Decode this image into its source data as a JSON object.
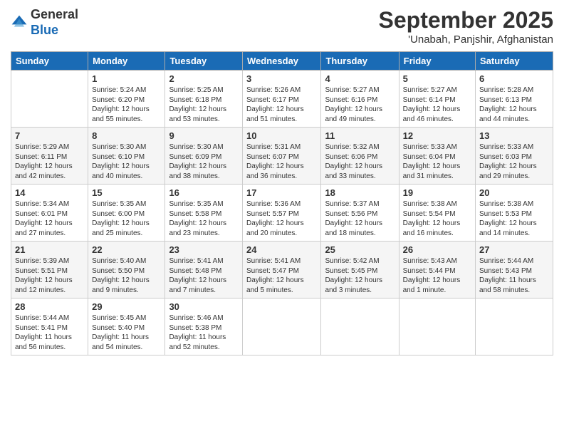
{
  "header": {
    "logo_general": "General",
    "logo_blue": "Blue",
    "month": "September 2025",
    "location": "'Unabah, Panjshir, Afghanistan"
  },
  "columns": [
    "Sunday",
    "Monday",
    "Tuesday",
    "Wednesday",
    "Thursday",
    "Friday",
    "Saturday"
  ],
  "weeks": [
    [
      {
        "day": "",
        "info": ""
      },
      {
        "day": "1",
        "info": "Sunrise: 5:24 AM\nSunset: 6:20 PM\nDaylight: 12 hours\nand 55 minutes."
      },
      {
        "day": "2",
        "info": "Sunrise: 5:25 AM\nSunset: 6:18 PM\nDaylight: 12 hours\nand 53 minutes."
      },
      {
        "day": "3",
        "info": "Sunrise: 5:26 AM\nSunset: 6:17 PM\nDaylight: 12 hours\nand 51 minutes."
      },
      {
        "day": "4",
        "info": "Sunrise: 5:27 AM\nSunset: 6:16 PM\nDaylight: 12 hours\nand 49 minutes."
      },
      {
        "day": "5",
        "info": "Sunrise: 5:27 AM\nSunset: 6:14 PM\nDaylight: 12 hours\nand 46 minutes."
      },
      {
        "day": "6",
        "info": "Sunrise: 5:28 AM\nSunset: 6:13 PM\nDaylight: 12 hours\nand 44 minutes."
      }
    ],
    [
      {
        "day": "7",
        "info": "Sunrise: 5:29 AM\nSunset: 6:11 PM\nDaylight: 12 hours\nand 42 minutes."
      },
      {
        "day": "8",
        "info": "Sunrise: 5:30 AM\nSunset: 6:10 PM\nDaylight: 12 hours\nand 40 minutes."
      },
      {
        "day": "9",
        "info": "Sunrise: 5:30 AM\nSunset: 6:09 PM\nDaylight: 12 hours\nand 38 minutes."
      },
      {
        "day": "10",
        "info": "Sunrise: 5:31 AM\nSunset: 6:07 PM\nDaylight: 12 hours\nand 36 minutes."
      },
      {
        "day": "11",
        "info": "Sunrise: 5:32 AM\nSunset: 6:06 PM\nDaylight: 12 hours\nand 33 minutes."
      },
      {
        "day": "12",
        "info": "Sunrise: 5:33 AM\nSunset: 6:04 PM\nDaylight: 12 hours\nand 31 minutes."
      },
      {
        "day": "13",
        "info": "Sunrise: 5:33 AM\nSunset: 6:03 PM\nDaylight: 12 hours\nand 29 minutes."
      }
    ],
    [
      {
        "day": "14",
        "info": "Sunrise: 5:34 AM\nSunset: 6:01 PM\nDaylight: 12 hours\nand 27 minutes."
      },
      {
        "day": "15",
        "info": "Sunrise: 5:35 AM\nSunset: 6:00 PM\nDaylight: 12 hours\nand 25 minutes."
      },
      {
        "day": "16",
        "info": "Sunrise: 5:35 AM\nSunset: 5:58 PM\nDaylight: 12 hours\nand 23 minutes."
      },
      {
        "day": "17",
        "info": "Sunrise: 5:36 AM\nSunset: 5:57 PM\nDaylight: 12 hours\nand 20 minutes."
      },
      {
        "day": "18",
        "info": "Sunrise: 5:37 AM\nSunset: 5:56 PM\nDaylight: 12 hours\nand 18 minutes."
      },
      {
        "day": "19",
        "info": "Sunrise: 5:38 AM\nSunset: 5:54 PM\nDaylight: 12 hours\nand 16 minutes."
      },
      {
        "day": "20",
        "info": "Sunrise: 5:38 AM\nSunset: 5:53 PM\nDaylight: 12 hours\nand 14 minutes."
      }
    ],
    [
      {
        "day": "21",
        "info": "Sunrise: 5:39 AM\nSunset: 5:51 PM\nDaylight: 12 hours\nand 12 minutes."
      },
      {
        "day": "22",
        "info": "Sunrise: 5:40 AM\nSunset: 5:50 PM\nDaylight: 12 hours\nand 9 minutes."
      },
      {
        "day": "23",
        "info": "Sunrise: 5:41 AM\nSunset: 5:48 PM\nDaylight: 12 hours\nand 7 minutes."
      },
      {
        "day": "24",
        "info": "Sunrise: 5:41 AM\nSunset: 5:47 PM\nDaylight: 12 hours\nand 5 minutes."
      },
      {
        "day": "25",
        "info": "Sunrise: 5:42 AM\nSunset: 5:45 PM\nDaylight: 12 hours\nand 3 minutes."
      },
      {
        "day": "26",
        "info": "Sunrise: 5:43 AM\nSunset: 5:44 PM\nDaylight: 12 hours\nand 1 minute."
      },
      {
        "day": "27",
        "info": "Sunrise: 5:44 AM\nSunset: 5:43 PM\nDaylight: 11 hours\nand 58 minutes."
      }
    ],
    [
      {
        "day": "28",
        "info": "Sunrise: 5:44 AM\nSunset: 5:41 PM\nDaylight: 11 hours\nand 56 minutes."
      },
      {
        "day": "29",
        "info": "Sunrise: 5:45 AM\nSunset: 5:40 PM\nDaylight: 11 hours\nand 54 minutes."
      },
      {
        "day": "30",
        "info": "Sunrise: 5:46 AM\nSunset: 5:38 PM\nDaylight: 11 hours\nand 52 minutes."
      },
      {
        "day": "",
        "info": ""
      },
      {
        "day": "",
        "info": ""
      },
      {
        "day": "",
        "info": ""
      },
      {
        "day": "",
        "info": ""
      }
    ]
  ]
}
